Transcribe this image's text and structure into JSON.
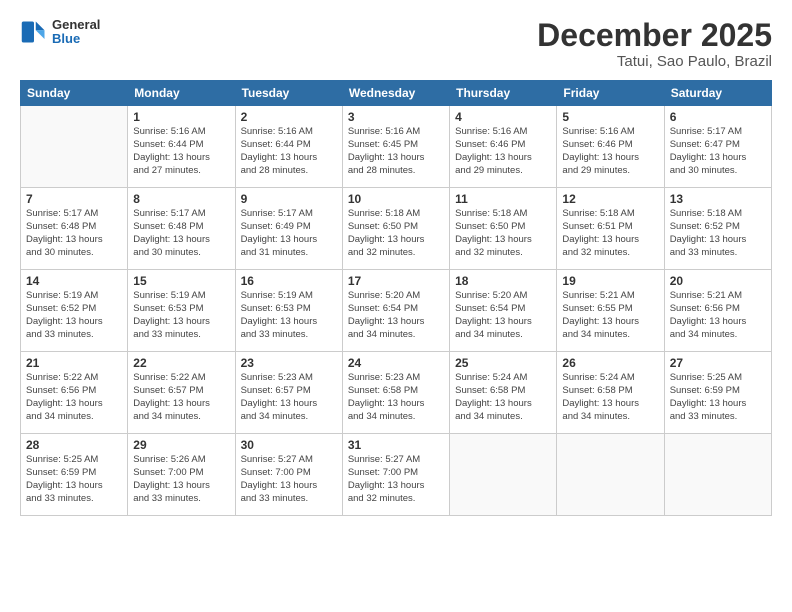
{
  "logo": {
    "line1": "General",
    "line2": "Blue"
  },
  "title": "December 2025",
  "subtitle": "Tatui, Sao Paulo, Brazil",
  "days_of_week": [
    "Sunday",
    "Monday",
    "Tuesday",
    "Wednesday",
    "Thursday",
    "Friday",
    "Saturday"
  ],
  "weeks": [
    [
      {
        "day": "",
        "info": ""
      },
      {
        "day": "1",
        "info": "Sunrise: 5:16 AM\nSunset: 6:44 PM\nDaylight: 13 hours\nand 27 minutes."
      },
      {
        "day": "2",
        "info": "Sunrise: 5:16 AM\nSunset: 6:44 PM\nDaylight: 13 hours\nand 28 minutes."
      },
      {
        "day": "3",
        "info": "Sunrise: 5:16 AM\nSunset: 6:45 PM\nDaylight: 13 hours\nand 28 minutes."
      },
      {
        "day": "4",
        "info": "Sunrise: 5:16 AM\nSunset: 6:46 PM\nDaylight: 13 hours\nand 29 minutes."
      },
      {
        "day": "5",
        "info": "Sunrise: 5:16 AM\nSunset: 6:46 PM\nDaylight: 13 hours\nand 29 minutes."
      },
      {
        "day": "6",
        "info": "Sunrise: 5:17 AM\nSunset: 6:47 PM\nDaylight: 13 hours\nand 30 minutes."
      }
    ],
    [
      {
        "day": "7",
        "info": "Sunrise: 5:17 AM\nSunset: 6:48 PM\nDaylight: 13 hours\nand 30 minutes."
      },
      {
        "day": "8",
        "info": "Sunrise: 5:17 AM\nSunset: 6:48 PM\nDaylight: 13 hours\nand 30 minutes."
      },
      {
        "day": "9",
        "info": "Sunrise: 5:17 AM\nSunset: 6:49 PM\nDaylight: 13 hours\nand 31 minutes."
      },
      {
        "day": "10",
        "info": "Sunrise: 5:18 AM\nSunset: 6:50 PM\nDaylight: 13 hours\nand 32 minutes."
      },
      {
        "day": "11",
        "info": "Sunrise: 5:18 AM\nSunset: 6:50 PM\nDaylight: 13 hours\nand 32 minutes."
      },
      {
        "day": "12",
        "info": "Sunrise: 5:18 AM\nSunset: 6:51 PM\nDaylight: 13 hours\nand 32 minutes."
      },
      {
        "day": "13",
        "info": "Sunrise: 5:18 AM\nSunset: 6:52 PM\nDaylight: 13 hours\nand 33 minutes."
      }
    ],
    [
      {
        "day": "14",
        "info": "Sunrise: 5:19 AM\nSunset: 6:52 PM\nDaylight: 13 hours\nand 33 minutes."
      },
      {
        "day": "15",
        "info": "Sunrise: 5:19 AM\nSunset: 6:53 PM\nDaylight: 13 hours\nand 33 minutes."
      },
      {
        "day": "16",
        "info": "Sunrise: 5:19 AM\nSunset: 6:53 PM\nDaylight: 13 hours\nand 33 minutes."
      },
      {
        "day": "17",
        "info": "Sunrise: 5:20 AM\nSunset: 6:54 PM\nDaylight: 13 hours\nand 34 minutes."
      },
      {
        "day": "18",
        "info": "Sunrise: 5:20 AM\nSunset: 6:54 PM\nDaylight: 13 hours\nand 34 minutes."
      },
      {
        "day": "19",
        "info": "Sunrise: 5:21 AM\nSunset: 6:55 PM\nDaylight: 13 hours\nand 34 minutes."
      },
      {
        "day": "20",
        "info": "Sunrise: 5:21 AM\nSunset: 6:56 PM\nDaylight: 13 hours\nand 34 minutes."
      }
    ],
    [
      {
        "day": "21",
        "info": "Sunrise: 5:22 AM\nSunset: 6:56 PM\nDaylight: 13 hours\nand 34 minutes."
      },
      {
        "day": "22",
        "info": "Sunrise: 5:22 AM\nSunset: 6:57 PM\nDaylight: 13 hours\nand 34 minutes."
      },
      {
        "day": "23",
        "info": "Sunrise: 5:23 AM\nSunset: 6:57 PM\nDaylight: 13 hours\nand 34 minutes."
      },
      {
        "day": "24",
        "info": "Sunrise: 5:23 AM\nSunset: 6:58 PM\nDaylight: 13 hours\nand 34 minutes."
      },
      {
        "day": "25",
        "info": "Sunrise: 5:24 AM\nSunset: 6:58 PM\nDaylight: 13 hours\nand 34 minutes."
      },
      {
        "day": "26",
        "info": "Sunrise: 5:24 AM\nSunset: 6:58 PM\nDaylight: 13 hours\nand 34 minutes."
      },
      {
        "day": "27",
        "info": "Sunrise: 5:25 AM\nSunset: 6:59 PM\nDaylight: 13 hours\nand 33 minutes."
      }
    ],
    [
      {
        "day": "28",
        "info": "Sunrise: 5:25 AM\nSunset: 6:59 PM\nDaylight: 13 hours\nand 33 minutes."
      },
      {
        "day": "29",
        "info": "Sunrise: 5:26 AM\nSunset: 7:00 PM\nDaylight: 13 hours\nand 33 minutes."
      },
      {
        "day": "30",
        "info": "Sunrise: 5:27 AM\nSunset: 7:00 PM\nDaylight: 13 hours\nand 33 minutes."
      },
      {
        "day": "31",
        "info": "Sunrise: 5:27 AM\nSunset: 7:00 PM\nDaylight: 13 hours\nand 32 minutes."
      },
      {
        "day": "",
        "info": ""
      },
      {
        "day": "",
        "info": ""
      },
      {
        "day": "",
        "info": ""
      }
    ]
  ]
}
